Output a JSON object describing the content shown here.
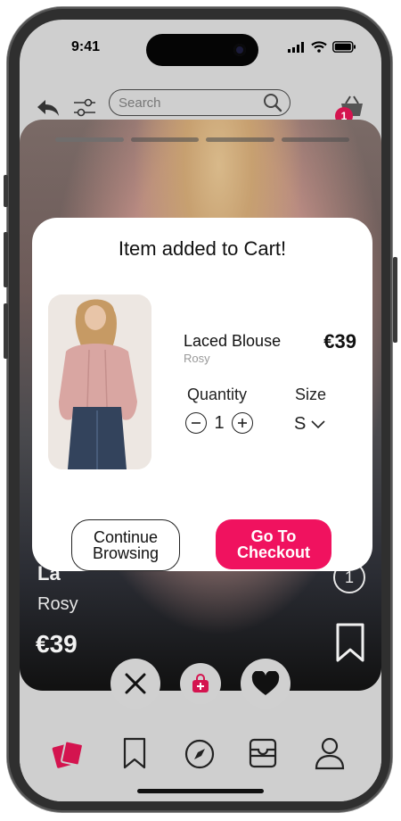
{
  "status": {
    "time": "9:41"
  },
  "topbar": {
    "search_placeholder": "Search",
    "cart_count": "1"
  },
  "card": {
    "title_partial": "La",
    "color": "Rosy",
    "price": "€39",
    "counter": "1"
  },
  "modal": {
    "title": "Item added to Cart!",
    "product_name": "Laced Blouse",
    "product_color": "Rosy",
    "price": "€39",
    "quantity_label": "Quantity",
    "quantity_value": "1",
    "size_label": "Size",
    "size_value": "S",
    "continue_label_line1": "Continue",
    "continue_label_line2": "Browsing",
    "checkout_label_line1": "Go To",
    "checkout_label_line2": "Checkout"
  },
  "colors": {
    "accent": "#f0125f",
    "badge": "#d4144f",
    "nav_active": "#d4144f"
  },
  "nav": {
    "items": [
      "cards-icon",
      "bookmark-icon",
      "compass-icon",
      "inbox-icon",
      "user-icon"
    ]
  }
}
